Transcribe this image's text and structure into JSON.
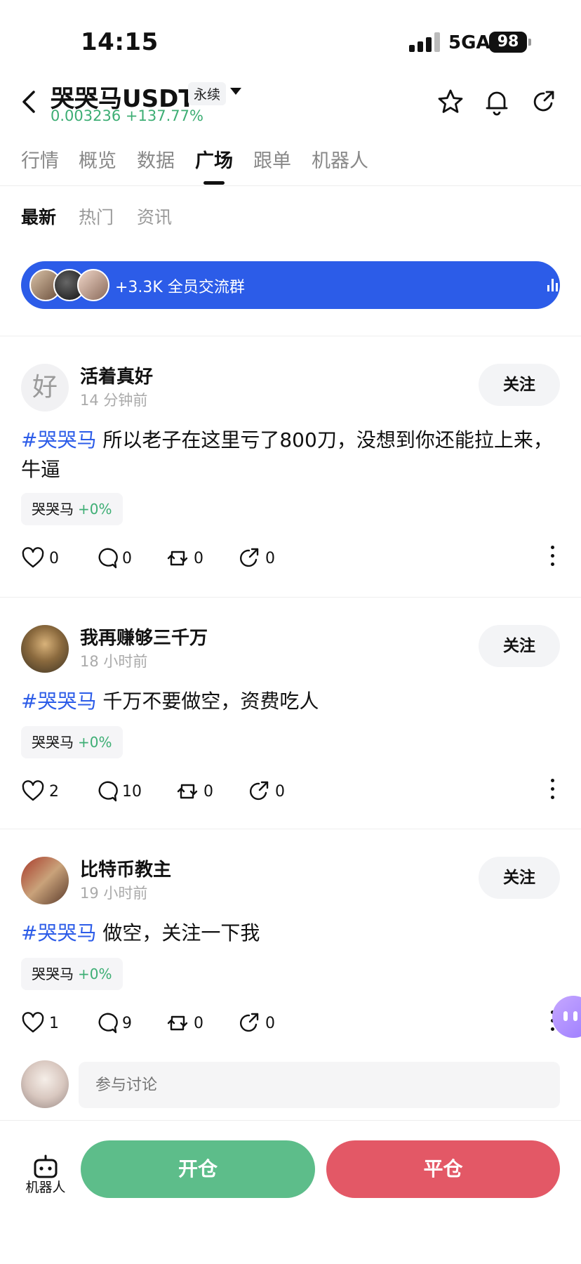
{
  "status_bar": {
    "time": "14:15",
    "network": "5GA",
    "battery": "98"
  },
  "header": {
    "title": "哭哭马USDT",
    "badge": "永续",
    "price": "0.003236",
    "change": "+137.77%"
  },
  "tabs": [
    {
      "label": "行情"
    },
    {
      "label": "概览"
    },
    {
      "label": "数据"
    },
    {
      "label": "广场"
    },
    {
      "label": "跟单"
    },
    {
      "label": "机器人"
    }
  ],
  "active_tab": "广场",
  "subtabs": [
    {
      "label": "最新"
    },
    {
      "label": "热门"
    },
    {
      "label": "资讯"
    }
  ],
  "group_banner": {
    "text": "+3.3K 全员交流群"
  },
  "posts": [
    {
      "avatar_text": "好",
      "name": "活着真好",
      "time": "14 分钟前",
      "follow_label": "关注",
      "hashtag": "#哭哭马",
      "body": " 所以老子在这里亏了800刀，没想到你还能拉上来，牛逼",
      "chip_name": "哭哭马",
      "chip_pct": "+0%",
      "likes": "0",
      "comments": "0",
      "reposts": "0",
      "shares": "0"
    },
    {
      "avatar_text": "",
      "name": "我再赚够三千万",
      "time": "18 小时前",
      "follow_label": "关注",
      "hashtag": "#哭哭马",
      "body": " 千万不要做空，资费吃人",
      "chip_name": "哭哭马",
      "chip_pct": "+0%",
      "likes": "2",
      "comments": "10",
      "reposts": "0",
      "shares": "0"
    },
    {
      "avatar_text": "",
      "name": "比特币教主",
      "time": "19 小时前",
      "follow_label": "关注",
      "hashtag": "#哭哭马",
      "body": " 做空，关注一下我",
      "chip_name": "哭哭马",
      "chip_pct": "+0%",
      "likes": "1",
      "comments": "9",
      "reposts": "0",
      "shares": "0"
    }
  ],
  "comment": {
    "placeholder": "参与讨论"
  },
  "bottom_bar": {
    "robot_label": "机器人",
    "open_label": "开仓",
    "close_label": "平仓"
  },
  "colors": {
    "accent_blue": "#2c5ce8",
    "up_green": "#3dae74",
    "open_green": "#5dbd8a",
    "close_red": "#e35866"
  }
}
